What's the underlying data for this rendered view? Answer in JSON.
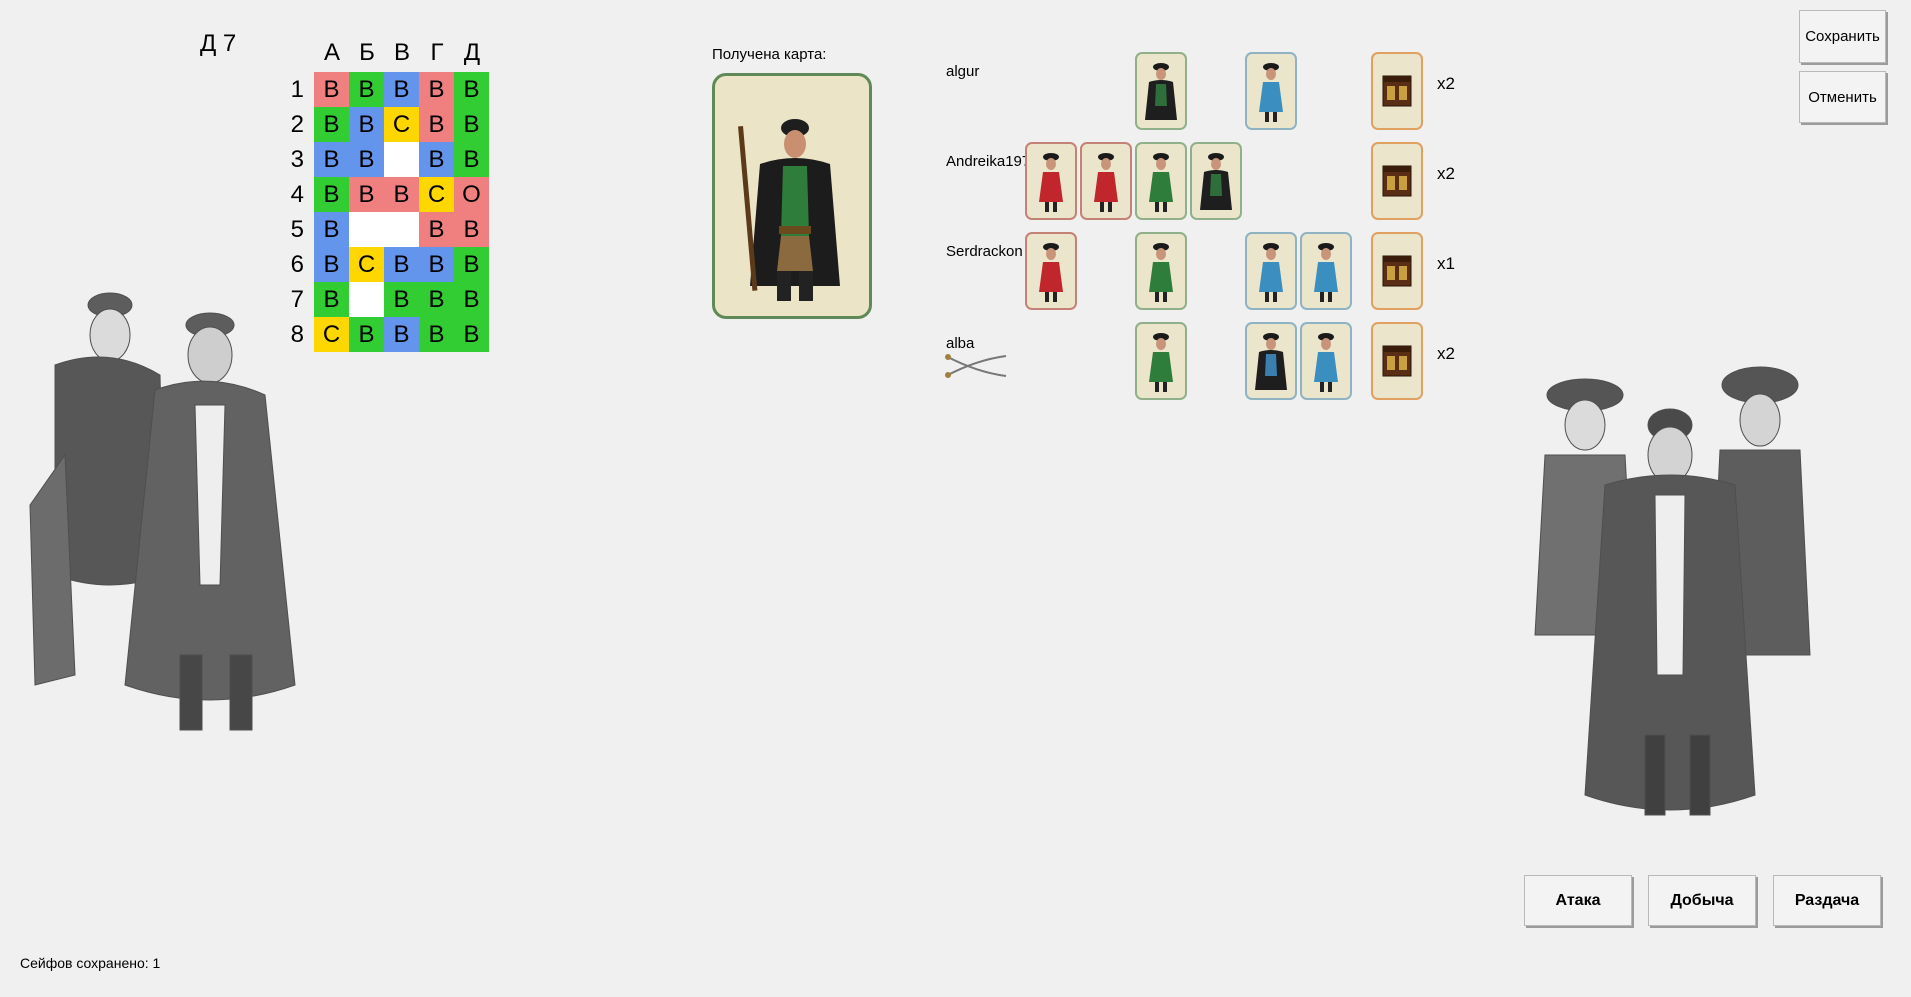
{
  "colors": {
    "red": "#f08080",
    "green": "#32cd32",
    "blue": "#6495ed",
    "yellow": "#ffd700",
    "empty": "#ffffff",
    "background": "#f0f0f0"
  },
  "board": {
    "coordinate": "Д 7",
    "columns": [
      "А",
      "Б",
      "В",
      "Г",
      "Д"
    ],
    "rows": [
      "1",
      "2",
      "3",
      "4",
      "5",
      "6",
      "7",
      "8"
    ],
    "cells": [
      [
        {
          "t": "В",
          "c": "red"
        },
        {
          "t": "В",
          "c": "green"
        },
        {
          "t": "В",
          "c": "blue"
        },
        {
          "t": "В",
          "c": "red"
        },
        {
          "t": "В",
          "c": "green"
        }
      ],
      [
        {
          "t": "В",
          "c": "green"
        },
        {
          "t": "В",
          "c": "blue"
        },
        {
          "t": "С",
          "c": "yellow"
        },
        {
          "t": "В",
          "c": "red"
        },
        {
          "t": "В",
          "c": "green"
        }
      ],
      [
        {
          "t": "В",
          "c": "blue"
        },
        {
          "t": "В",
          "c": "blue"
        },
        {
          "t": "",
          "c": "empty"
        },
        {
          "t": "В",
          "c": "blue"
        },
        {
          "t": "В",
          "c": "green"
        }
      ],
      [
        {
          "t": "В",
          "c": "green"
        },
        {
          "t": "В",
          "c": "red"
        },
        {
          "t": "В",
          "c": "red"
        },
        {
          "t": "С",
          "c": "yellow"
        },
        {
          "t": "О",
          "c": "red"
        }
      ],
      [
        {
          "t": "В",
          "c": "blue"
        },
        {
          "t": "",
          "c": "empty"
        },
        {
          "t": "",
          "c": "empty"
        },
        {
          "t": "В",
          "c": "red"
        },
        {
          "t": "В",
          "c": "red"
        }
      ],
      [
        {
          "t": "В",
          "c": "blue"
        },
        {
          "t": "С",
          "c": "yellow"
        },
        {
          "t": "В",
          "c": "blue"
        },
        {
          "t": "В",
          "c": "blue"
        },
        {
          "t": "В",
          "c": "green"
        }
      ],
      [
        {
          "t": "В",
          "c": "green"
        },
        {
          "t": "",
          "c": "empty"
        },
        {
          "t": "В",
          "c": "green"
        },
        {
          "t": "В",
          "c": "green"
        },
        {
          "t": "В",
          "c": "green"
        }
      ],
      [
        {
          "t": "С",
          "c": "yellow"
        },
        {
          "t": "В",
          "c": "green"
        },
        {
          "t": "В",
          "c": "blue"
        },
        {
          "t": "В",
          "c": "green"
        },
        {
          "t": "В",
          "c": "green"
        }
      ]
    ]
  },
  "received": {
    "label": "Получена карта:",
    "card": "pirate-musketeer-card"
  },
  "players": [
    {
      "name": "algur",
      "multiplier": "x2",
      "cards": [
        null,
        null,
        "green-captain",
        null,
        "blue-lady",
        null,
        "chest"
      ]
    },
    {
      "name": "Andreika197",
      "multiplier": "x2",
      "cards": [
        "red-lady",
        "red-lady",
        "green-lady",
        "green-captain",
        null,
        null,
        "chest"
      ]
    },
    {
      "name": "Serdrackon",
      "multiplier": "x1",
      "cards": [
        "red-lady",
        null,
        "green-lady",
        null,
        "blue-lady",
        "blue-lady",
        "chest"
      ]
    },
    {
      "name": "alba",
      "multiplier": "x2",
      "cards": [
        null,
        null,
        "green-lady",
        null,
        "blue-captain",
        "blue-lady",
        "chest"
      ],
      "icon": "crossed-sabers-icon"
    }
  ],
  "buttons": {
    "save": "Сохранить",
    "cancel": "Отменить",
    "attack": "Атака",
    "loot": "Добыча",
    "deal": "Раздача"
  },
  "status": "Сейфов сохранено: 1"
}
